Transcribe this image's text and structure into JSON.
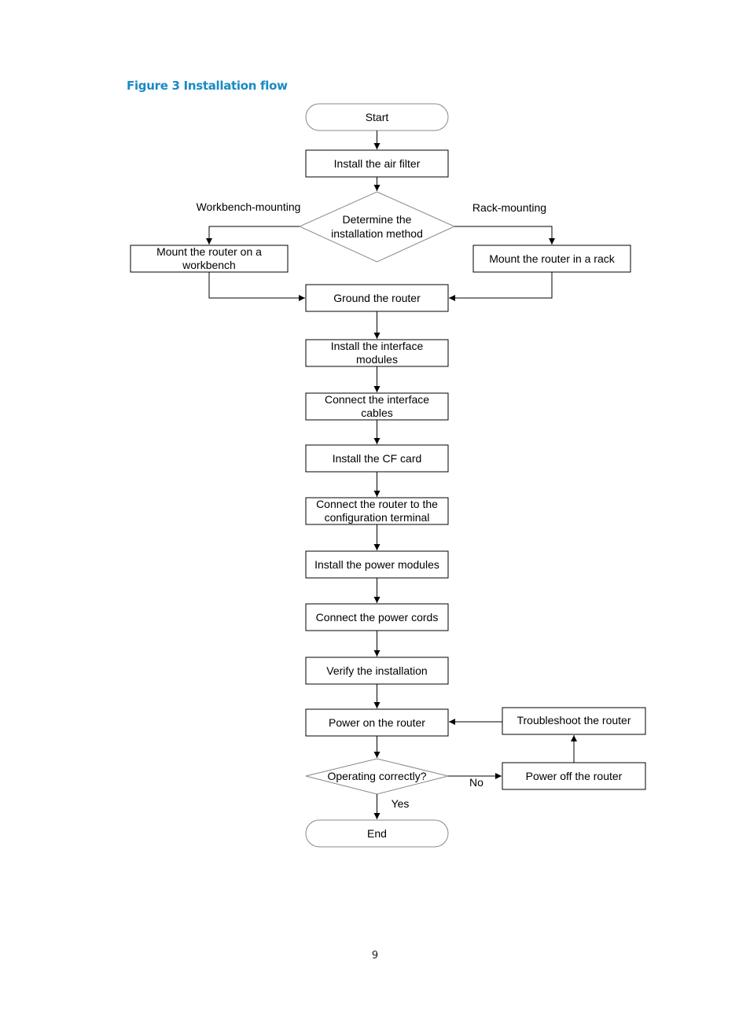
{
  "figure": {
    "title": "Figure 3 Installation flow"
  },
  "page": {
    "number": "9"
  },
  "flow": {
    "start": "Start",
    "air_filter": "Install the air filter",
    "decision_method": [
      "Determine the",
      "installation method"
    ],
    "branch_workbench_label": "Workbench-mounting",
    "branch_rack_label": "Rack-mounting",
    "workbench": [
      "Mount the router on a",
      "workbench"
    ],
    "rack": "Mount the router in a rack",
    "ground": "Ground the router",
    "interface_modules": [
      "Install the interface",
      "modules"
    ],
    "interface_cables": [
      "Connect the interface",
      "cables"
    ],
    "cf_card": "Install the CF card",
    "config_terminal": [
      "Connect the router to the",
      "configuration terminal"
    ],
    "power_modules": "Install the power modules",
    "power_cords": "Connect the power cords",
    "verify": "Verify the installation",
    "power_on": "Power on the router",
    "decision_operating": "Operating correctly?",
    "yes_label": "Yes",
    "no_label": "No",
    "power_off": "Power off the router",
    "troubleshoot": "Troubleshoot the router",
    "end": "End"
  }
}
